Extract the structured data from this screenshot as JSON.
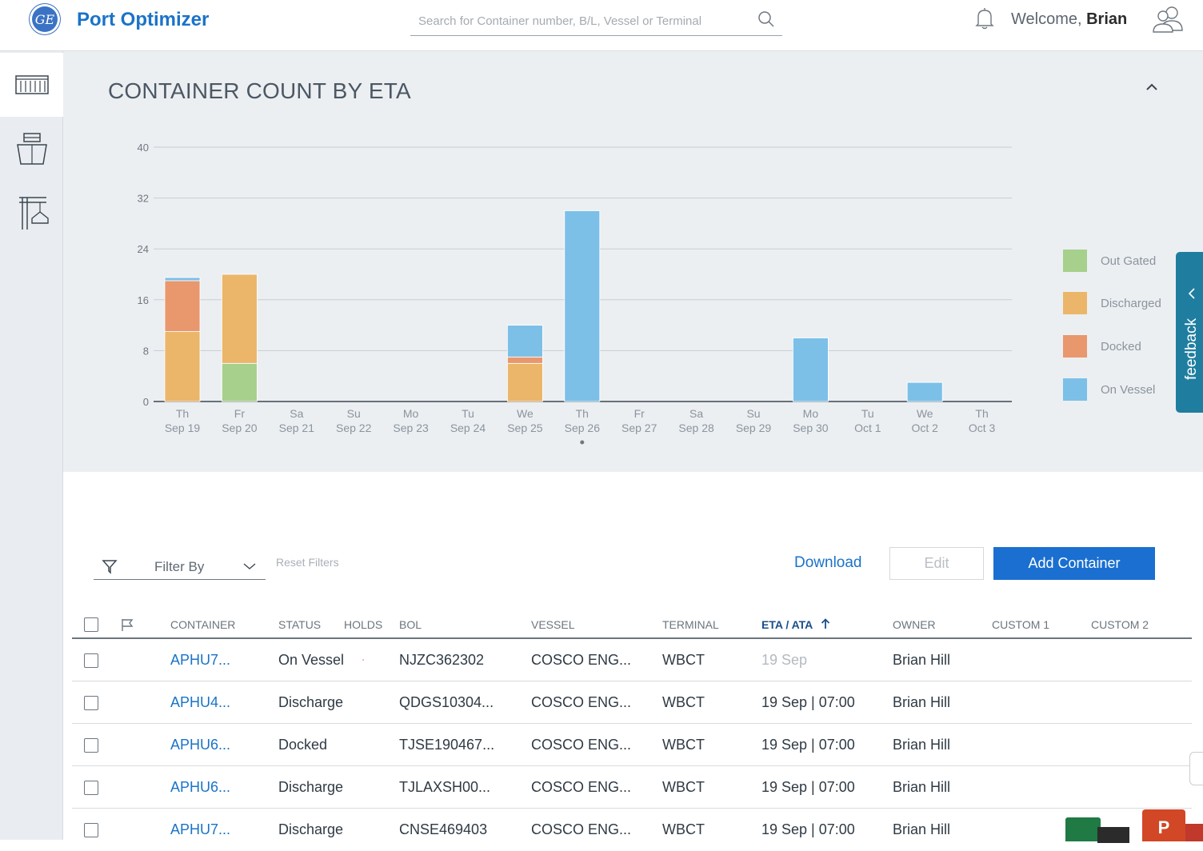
{
  "header": {
    "logo_text": "GE",
    "app_title": "Port Optimizer",
    "search_placeholder": "Search for Container number, B/L, Vessel or Terminal",
    "welcome_prefix": "Welcome,",
    "user_name": "Brian"
  },
  "sidebar": {
    "items": [
      {
        "icon": "container-icon",
        "active": true
      },
      {
        "icon": "ship-icon",
        "active": false
      },
      {
        "icon": "crane-icon",
        "active": false
      }
    ]
  },
  "chart_panel": {
    "title": "CONTAINER COUNT BY ETA"
  },
  "chart_data": {
    "type": "bar",
    "stacked": true,
    "title": "CONTAINER COUNT BY ETA",
    "ylim": [
      0,
      40
    ],
    "yticks": [
      0,
      8,
      16,
      24,
      32,
      40
    ],
    "categories": [
      {
        "day": "Th",
        "date": "Sep 19"
      },
      {
        "day": "Fr",
        "date": "Sep 20"
      },
      {
        "day": "Sa",
        "date": "Sep 21"
      },
      {
        "day": "Su",
        "date": "Sep 22"
      },
      {
        "day": "Mo",
        "date": "Sep 23"
      },
      {
        "day": "Tu",
        "date": "Sep 24"
      },
      {
        "day": "We",
        "date": "Sep 25"
      },
      {
        "day": "Th",
        "date": "Sep 26"
      },
      {
        "day": "Fr",
        "date": "Sep 27"
      },
      {
        "day": "Sa",
        "date": "Sep 28"
      },
      {
        "day": "Su",
        "date": "Sep 29"
      },
      {
        "day": "Mo",
        "date": "Sep 30"
      },
      {
        "day": "Tu",
        "date": "Oct 1"
      },
      {
        "day": "We",
        "date": "Oct 2"
      },
      {
        "day": "Th",
        "date": "Oct 3"
      }
    ],
    "series": [
      {
        "name": "Out Gated",
        "color": "#a6d08c",
        "values": [
          0,
          6,
          0,
          0,
          0,
          0,
          0,
          0,
          0,
          0,
          0,
          0,
          0,
          0,
          0
        ]
      },
      {
        "name": "Discharged",
        "color": "#ebb66a",
        "values": [
          11,
          14,
          0,
          0,
          0,
          0,
          6,
          0,
          0,
          0,
          0,
          0,
          0,
          0,
          0
        ]
      },
      {
        "name": "Docked",
        "color": "#e9976d",
        "values": [
          8,
          0,
          0,
          0,
          0,
          0,
          1,
          0,
          0,
          0,
          0,
          0,
          0,
          0,
          0
        ]
      },
      {
        "name": "On Vessel",
        "color": "#7cc0e8",
        "values": [
          0.5,
          0,
          0,
          0,
          0,
          0,
          5,
          30,
          0,
          0,
          0,
          10,
          0,
          3,
          0
        ]
      }
    ],
    "grid": true,
    "legend_position": "right",
    "legend_order": [
      "Out Gated",
      "Discharged",
      "Docked",
      "On Vessel"
    ],
    "highlighted_category": "Sep 26"
  },
  "feedback": {
    "label": "feedback"
  },
  "toolbar": {
    "filter_label": "Filter By",
    "reset_label": "Reset Filters",
    "download_label": "Download",
    "edit_label": "Edit",
    "add_label": "Add Container"
  },
  "table": {
    "columns": {
      "container": "CONTAINER",
      "status": "STATUS",
      "holds": "HOLDS",
      "bol": "BOL",
      "vessel": "VESSEL",
      "terminal": "TERMINAL",
      "eta": "ETA / ATA",
      "owner": "OWNER",
      "custom1": "CUSTOM 1",
      "custom2": "CUSTOM 2"
    },
    "rows": [
      {
        "container": "APHU7...",
        "status": "On Vessel",
        "bol": "NJZC362302",
        "vessel": "COSCO ENG...",
        "terminal": "WBCT",
        "eta": "19 Sep",
        "owner": "Brian Hill"
      },
      {
        "container": "APHU4...",
        "status": "Discharge",
        "bol": "QDGS10304...",
        "vessel": "COSCO ENG...",
        "terminal": "WBCT",
        "eta": "19 Sep | 07:00",
        "owner": "Brian Hill"
      },
      {
        "container": "APHU6...",
        "status": "Docked",
        "bol": "TJSE190467...",
        "vessel": "COSCO ENG...",
        "terminal": "WBCT",
        "eta": "19 Sep | 07:00",
        "owner": "Brian Hill"
      },
      {
        "container": "APHU6...",
        "status": "Discharge",
        "bol": "TJLAXSH00...",
        "vessel": "COSCO ENG...",
        "terminal": "WBCT",
        "eta": "19 Sep | 07:00",
        "owner": "Brian Hill"
      },
      {
        "container": "APHU7...",
        "status": "Discharge",
        "bol": "CNSE469403",
        "vessel": "COSCO ENG...",
        "terminal": "WBCT",
        "eta": "19 Sep | 07:00",
        "owner": "Brian Hill"
      }
    ]
  },
  "taskbar": {
    "ppt_letter": "P"
  }
}
